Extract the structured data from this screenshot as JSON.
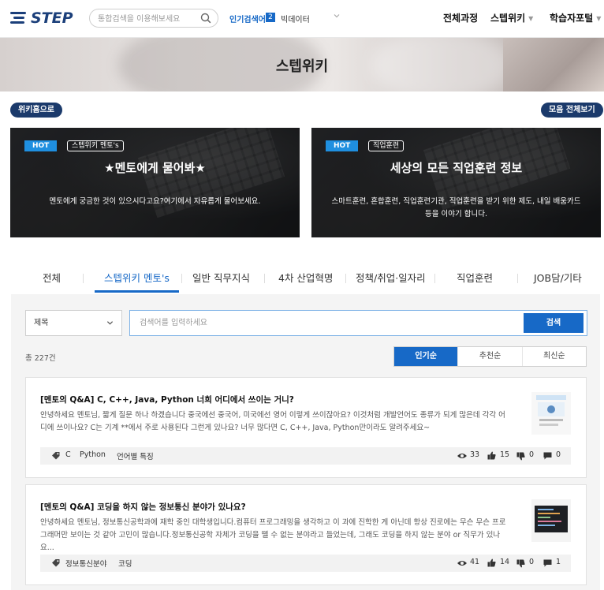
{
  "header": {
    "logo_text": "STEP",
    "search_placeholder": "통합검색을 이용해보세요",
    "hot_keyword_label": "인기검색어",
    "hot_keyword_rank": "2",
    "hot_keyword_word": "빅데이터",
    "menu": [
      "전체과정",
      "스텝위키",
      "학습자포털"
    ]
  },
  "hero": {
    "title": "스텝위키"
  },
  "buttons": {
    "wiki_home": "위키홈으로",
    "view_all": "모음 전체보기"
  },
  "cards": [
    {
      "hot": "HOT",
      "category": "스텝위키 멘토's",
      "title": "★멘토에게 물어봐★",
      "desc": "멘토에게 궁금한 것이 있으시다고요?여기에서 자유롭게 물어보세요."
    },
    {
      "hot": "HOT",
      "category": "직업훈련",
      "title": "세상의 모든 직업훈련 정보",
      "desc_line1": "스마트훈련, 혼합훈련, 직업훈련기관, 직업훈련을 받기 위한 제도, 내일 배움카드",
      "desc_line2": "등을 이야기 합니다."
    }
  ],
  "tabs": [
    "전체",
    "스텝위키 멘토's",
    "일반 직무지식",
    "4차 산업혁명",
    "정책/취업·일자리",
    "직업훈련",
    "JOB담/기타"
  ],
  "active_tab": "스텝위키 멘토's",
  "filter": {
    "select_value": "제목",
    "query_placeholder": "검색어를 입력하세요",
    "search_button": "검색"
  },
  "list": {
    "total": "총 227건",
    "sorts": [
      "인기순",
      "추천순",
      "최신순"
    ],
    "active_sort": "인기순"
  },
  "posts": [
    {
      "title": "[멘토의 Q&A] C, C++, Java, Python 너희 어디에서 쓰이는 거니?",
      "body_line1": "안녕하세요 멘토님, 짧게 질문 하나 하겠습니다 중국에선 중국어, 미국에선 영어 이렇게 쓰이잖아요? 이것처럼 개발언어도 종류가 되게 많은데 각각 어",
      "body_line2": "디에 쓰이나요? C는 기계 **에서 주로 사용된다 그런게 있나요? 너무 많다면 C, C++, Java, Python만이라도 알려주세요~",
      "tags": [
        "C",
        "Python",
        "언어별 특징"
      ],
      "views": "33",
      "likes": "15",
      "dislikes": "0",
      "comments": "0"
    },
    {
      "title": "[멘토의 Q&A] 코딩을 하지 않는 정보통신 분야가 있나요?",
      "body_line1": "안녕하세요 멘토님, 정보통신공학과에 재학 중인 대학생입니다.컴퓨터 프로그래밍을 생각하고 이 과에 진학한 게 아닌데 항상 진로에는 무슨 무슨 프로",
      "body_line2": "그래머만 보이는 것 같아 고민이 많습니다.정보통신공학 자체가 코딩을 뗄 수 없는 분야라고 들었는데, 그래도 코딩을 하지 않는 분야 or 직무가 있나요...",
      "tags": [
        "정보통신분야",
        "코딩"
      ],
      "views": "41",
      "likes": "14",
      "dislikes": "0",
      "comments": "1"
    }
  ],
  "colors": {
    "brand": "#1b3f7a",
    "accent": "#1769c7",
    "hot": "#1f8fe0"
  }
}
